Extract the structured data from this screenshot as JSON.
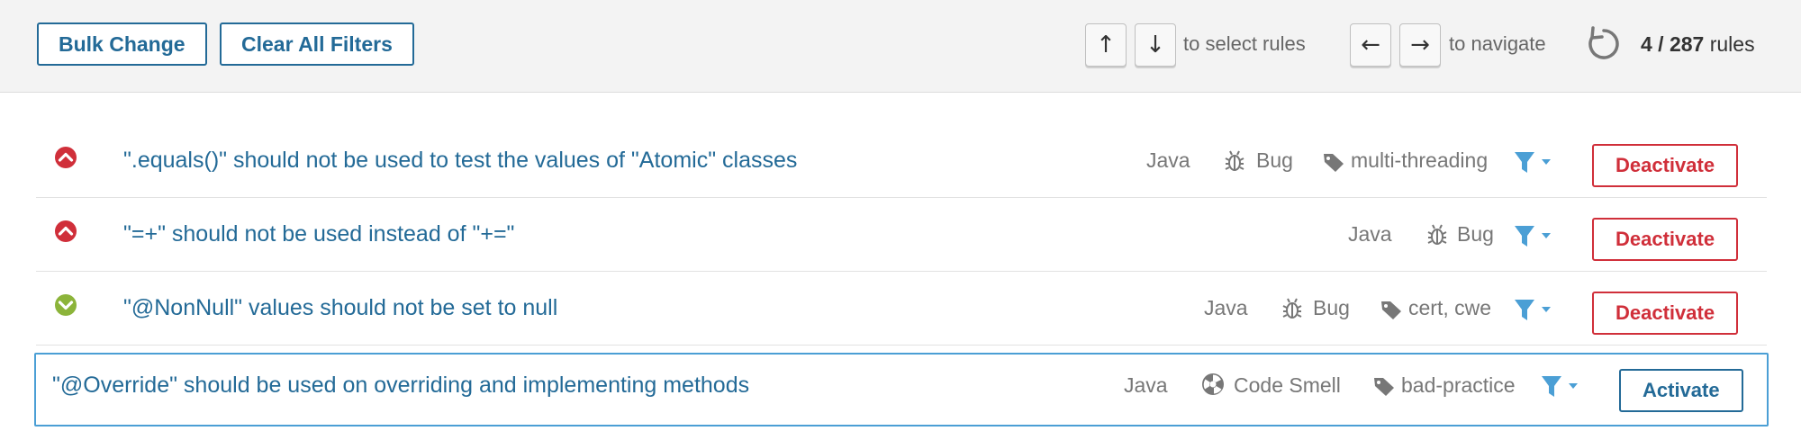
{
  "toolbar": {
    "bulk_change": "Bulk Change",
    "clear_filters": "Clear All Filters",
    "key_up": "↑",
    "key_down": "↓",
    "select_hint": "to select rules",
    "key_left": "←",
    "key_right": "→",
    "navigate_hint": "to navigate",
    "count_current": "4 / 287",
    "count_suffix": " rules"
  },
  "rules": [
    {
      "title": "\".equals()\" should not be used to test the values of \"Atomic\" classes",
      "severity": "critical",
      "language": "Java",
      "type": "Bug",
      "type_icon": "bug-icon",
      "tags": "multi-threading",
      "action": "Deactivate"
    },
    {
      "title": "\"=+\" should not be used instead of \"+=\"",
      "severity": "critical",
      "language": "Java",
      "type": "Bug",
      "type_icon": "bug-icon",
      "tags": "",
      "action": "Deactivate"
    },
    {
      "title": "\"@NonNull\" values should not be set to null",
      "severity": "minor",
      "language": "Java",
      "type": "Bug",
      "type_icon": "bug-icon",
      "tags": "cert, cwe",
      "action": "Deactivate"
    },
    {
      "title": "\"@Override\" should be used on overriding and implementing methods",
      "severity": "none",
      "language": "Java",
      "type": "Code Smell",
      "type_icon": "code-smell-icon",
      "tags": "bad-practice",
      "action": "Activate"
    }
  ],
  "colors": {
    "link": "#236a97",
    "critical": "#d02f3a",
    "minor": "#8cb43a",
    "filter": "#4b9fd5",
    "selected_border": "#4b9fd5"
  }
}
